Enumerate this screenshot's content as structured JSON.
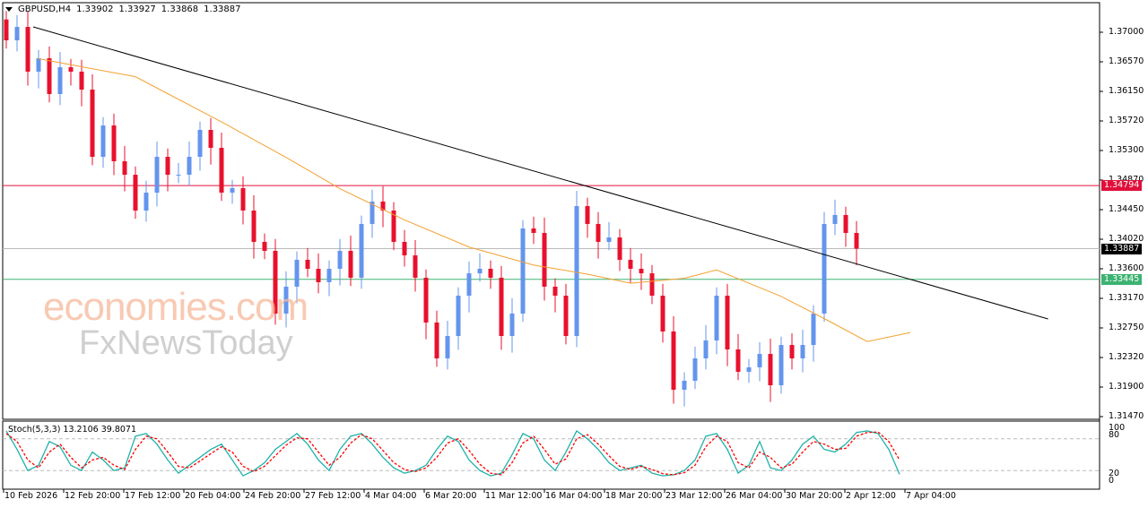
{
  "header": {
    "symbol": "GBPUSD,H4",
    "open": "1.33902",
    "high": "1.33927",
    "low": "1.33868",
    "close": "1.33887"
  },
  "watermark": {
    "line1": "economies.com",
    "line2": "FxNewsToday"
  },
  "price_axis": [
    "1.37000",
    "1.36570",
    "1.36150",
    "1.35720",
    "1.35300",
    "1.34870",
    "1.34450",
    "1.34020",
    "1.33600",
    "1.33170",
    "1.32750",
    "1.32320",
    "1.31900",
    "1.31470"
  ],
  "tags": {
    "resistance": {
      "value": "1.34794",
      "color": "#e0103a"
    },
    "current": {
      "value": "1.33887",
      "color": "#000000"
    },
    "support": {
      "value": "1.33445",
      "color": "#3cb371"
    }
  },
  "stoch": {
    "label": "Stoch(5,3,3) 13.2106 39.8071",
    "levels": [
      "100",
      "80",
      "20",
      "0"
    ]
  },
  "time_axis": [
    "10 Feb 2026",
    "12 Feb 20:00",
    "17 Feb 12:00",
    "20 Feb 04:00",
    "24 Feb 20:00",
    "27 Feb 12:00",
    "4 Mar 04:00",
    "6 Mar 20:00",
    "11 Mar 12:00",
    "16 Mar 04:00",
    "18 Mar 20:00",
    "23 Mar 12:00",
    "26 Mar 04:00",
    "30 Mar 20:00",
    "2 Apr 12:00",
    "7 Apr 04:00"
  ],
  "chart_data": {
    "type": "candlestick",
    "symbol": "GBPUSD",
    "timeframe": "H4",
    "ylim": [
      1.3147,
      1.3712
    ],
    "bull_color": "#6495ed",
    "bear_color": "#e8112d",
    "ma_color": "#f5a030",
    "trend_color": "#000000",
    "closes": [
      1.36884,
      1.37077,
      1.36433,
      1.36626,
      1.36111,
      1.36497,
      1.36433,
      1.36175,
      1.35208,
      1.35659,
      1.35144,
      1.3495,
      1.34435,
      1.34693,
      1.35208,
      1.3495,
      1.3495,
      1.35208,
      1.35595,
      1.35337,
      1.34693,
      1.34757,
      1.34435,
      1.33984,
      1.33855,
      1.32953,
      1.3334,
      1.33726,
      1.33597,
      1.33404,
      1.33597,
      1.33855,
      1.33468,
      1.34242,
      1.34564,
      1.34435,
      1.33984,
      1.3379,
      1.33468,
      1.32824,
      1.32308,
      1.3263,
      1.3321,
      1.33532,
      1.33597,
      1.33468,
      1.3263,
      1.32953,
      1.34177,
      1.34113,
      1.3334,
      1.3321,
      1.3263,
      1.34499,
      1.34242,
      1.33984,
      1.34048,
      1.33726,
      1.33597,
      1.33532,
      1.3321,
      1.32695,
      1.31857,
      1.31986,
      1.32308,
      1.32566,
      1.3321,
      1.32437,
      1.32115,
      1.32179,
      1.32372,
      1.31921,
      1.32501,
      1.32308,
      1.32501,
      1.32953,
      1.34242,
      1.34371,
      1.34113,
      1.33887
    ],
    "ma": [
      [
        3,
        1.3662
      ],
      [
        12,
        1.3636
      ],
      [
        20,
        1.3571
      ],
      [
        26,
        1.352
      ],
      [
        31,
        1.3475
      ],
      [
        37,
        1.343
      ],
      [
        43,
        1.3391
      ],
      [
        49,
        1.3365
      ],
      [
        54,
        1.3352
      ],
      [
        58,
        1.3339
      ],
      [
        63,
        1.3346
      ],
      [
        66,
        1.3358
      ],
      [
        69,
        1.3339
      ],
      [
        72,
        1.332
      ],
      [
        76,
        1.3288
      ],
      [
        80,
        1.3255
      ],
      [
        84,
        1.3268
      ]
    ],
    "trendline": [
      [
        2.5,
        1.37077
      ],
      [
        96.8,
        1.32875
      ]
    ],
    "hlines": [
      1.34794,
      1.33887,
      1.33445
    ],
    "stoch_main": [
      95,
      60,
      20,
      30,
      75,
      65,
      30,
      20,
      55,
      40,
      20,
      25,
      85,
      90,
      70,
      40,
      15,
      30,
      45,
      60,
      70,
      40,
      10,
      20,
      35,
      60,
      75,
      90,
      70,
      40,
      20,
      60,
      85,
      90,
      70,
      45,
      25,
      15,
      20,
      30,
      60,
      85,
      75,
      40,
      20,
      10,
      15,
      50,
      90,
      80,
      40,
      20,
      55,
      95,
      80,
      60,
      35,
      20,
      25,
      30,
      15,
      10,
      12,
      20,
      40,
      85,
      90,
      60,
      15,
      30,
      75,
      25,
      20,
      40,
      70,
      85,
      60,
      55,
      70,
      92,
      95,
      90,
      60,
      13
    ],
    "stoch_signal": [
      90,
      75,
      40,
      25,
      55,
      70,
      45,
      25,
      40,
      45,
      30,
      22,
      60,
      85,
      80,
      55,
      28,
      25,
      38,
      52,
      65,
      55,
      28,
      18,
      28,
      48,
      68,
      82,
      80,
      55,
      30,
      45,
      72,
      88,
      80,
      58,
      35,
      22,
      18,
      25,
      45,
      72,
      80,
      58,
      32,
      15,
      12,
      35,
      72,
      85,
      60,
      32,
      42,
      80,
      88,
      70,
      48,
      28,
      22,
      28,
      22,
      14,
      12,
      16,
      30,
      65,
      85,
      75,
      35,
      25,
      55,
      45,
      25,
      32,
      55,
      75,
      70,
      60,
      62,
      85,
      92,
      93,
      75,
      39.8
    ]
  }
}
